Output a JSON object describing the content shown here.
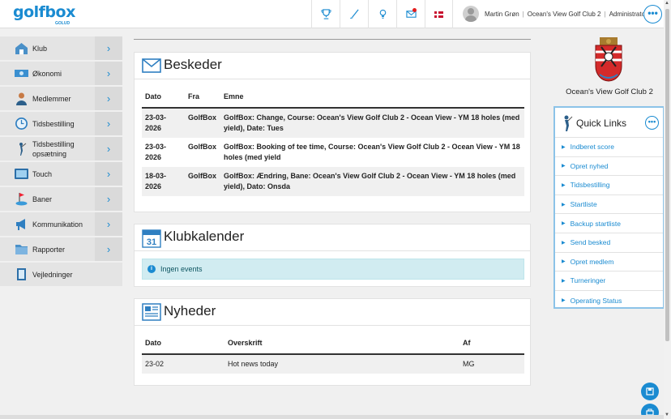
{
  "brand": {
    "logo": "golfbox",
    "logo_sub": "GOLUD"
  },
  "header": {
    "icons": [
      "trophy-icon",
      "golf-club-icon",
      "lightbulb-icon",
      "mail-notify-icon",
      "danish-flag-icon"
    ],
    "user_name": "Martin Grøn",
    "club": "Ocean's View Golf Club 2",
    "role": "Administrator",
    "more": "•••"
  },
  "sidebar": {
    "items": [
      {
        "label": "Klub",
        "icon": "home-icon"
      },
      {
        "label": "Økonomi",
        "icon": "money-icon"
      },
      {
        "label": "Medlemmer",
        "icon": "members-icon"
      },
      {
        "label": "Tidsbestilling",
        "icon": "clock-icon"
      },
      {
        "label": "Tidsbestilling opsætning",
        "icon": "golfer-icon"
      },
      {
        "label": "Touch",
        "icon": "touch-icon"
      },
      {
        "label": "Baner",
        "icon": "course-flag-icon"
      },
      {
        "label": "Kommunikation",
        "icon": "megaphone-icon"
      },
      {
        "label": "Rapporter",
        "icon": "folder-icon"
      },
      {
        "label": "Vejledninger",
        "icon": "guide-icon"
      }
    ]
  },
  "messages": {
    "title": "Beskeder",
    "columns": [
      "Dato",
      "Fra",
      "Emne"
    ],
    "rows": [
      {
        "date": "23-03-2026",
        "from": "GolfBox",
        "subject": "GolfBox: Change, Course: Ocean's View Golf Club 2 - Ocean View - YM 18 holes (med yield), Date: Tues"
      },
      {
        "date": "23-03-2026",
        "from": "GolfBox",
        "subject": "GolfBox: Booking of tee time, Course: Ocean's View Golf Club 2 - Ocean View - YM 18 holes (med yield"
      },
      {
        "date": "18-03-2026",
        "from": "GolfBox",
        "subject": "GolfBox: Ændring, Bane: Ocean's View Golf Club 2 - Ocean View - YM 18 holes (med yield), Dato: Onsda"
      }
    ]
  },
  "calendar": {
    "title": "Klubkalender",
    "day": "31",
    "empty": "Ingen events"
  },
  "news": {
    "title": "Nyheder",
    "columns": [
      "Dato",
      "Overskrift",
      "Af"
    ],
    "rows": [
      {
        "date": "23-02",
        "headline": "Hot news today",
        "by": "MG"
      }
    ]
  },
  "club_panel": {
    "name": "Ocean's View Golf Club 2"
  },
  "quick_links": {
    "title": "Quick Links",
    "more": "•••",
    "items": [
      "Indberet score",
      "Opret nyhed",
      "Tidsbestilling",
      "Startliste",
      "Backup startliste",
      "Send besked",
      "Opret medlem",
      "Turneringer",
      "Operating Status"
    ]
  },
  "colors": {
    "accent": "#1a8bd1",
    "notify": "#e31d1d",
    "info_bg": "#d1ecf1"
  }
}
